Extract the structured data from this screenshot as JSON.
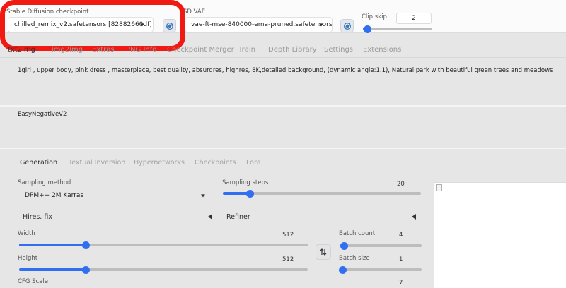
{
  "top": {
    "checkpoint": {
      "label": "Stable Diffusion checkpoint",
      "value": "chilled_remix_v2.safetensors [82882660df]"
    },
    "vae": {
      "label": "SD VAE",
      "value": "vae-ft-mse-840000-ema-pruned.safetensors"
    },
    "clip_skip": {
      "label": "Clip skip",
      "value": "2",
      "fraction": 0.05
    }
  },
  "tabs": [
    "txt2img",
    "img2img",
    "Extras",
    "PNG Info",
    "Checkpoint Merger",
    "Train",
    "Depth Library",
    "Settings",
    "Extensions"
  ],
  "prompt": "1girl , upper body, pink dress , masterpiece, best quality, absurdres, highres, 8K,detailed background, (dynamic angle:1.1), Natural park with beautiful green trees and meadows",
  "negative_prompt": "EasyNegativeV2",
  "subtabs": [
    "Generation",
    "Textual Inversion",
    "Hypernetworks",
    "Checkpoints",
    "Lora"
  ],
  "generation": {
    "sampling_method": {
      "label": "Sampling method",
      "value": "DPM++ 2M Karras"
    },
    "sampling_steps": {
      "label": "Sampling steps",
      "value": "20",
      "fraction": 0.14
    },
    "hires_fix": "Hires. fix",
    "refiner": "Refiner",
    "width": {
      "label": "Width",
      "value": "512",
      "fraction": 0.23
    },
    "height": {
      "label": "Height",
      "value": "512",
      "fraction": 0.23
    },
    "batch_count": {
      "label": "Batch count",
      "value": "4",
      "fraction": 0.03
    },
    "batch_size": {
      "label": "Batch size",
      "value": "1",
      "fraction": 0.0
    },
    "cfg_scale": {
      "label": "CFG Scale",
      "value": "7"
    }
  },
  "colors": {
    "accent": "#2f6ff0",
    "highlight": "#f01a12"
  }
}
